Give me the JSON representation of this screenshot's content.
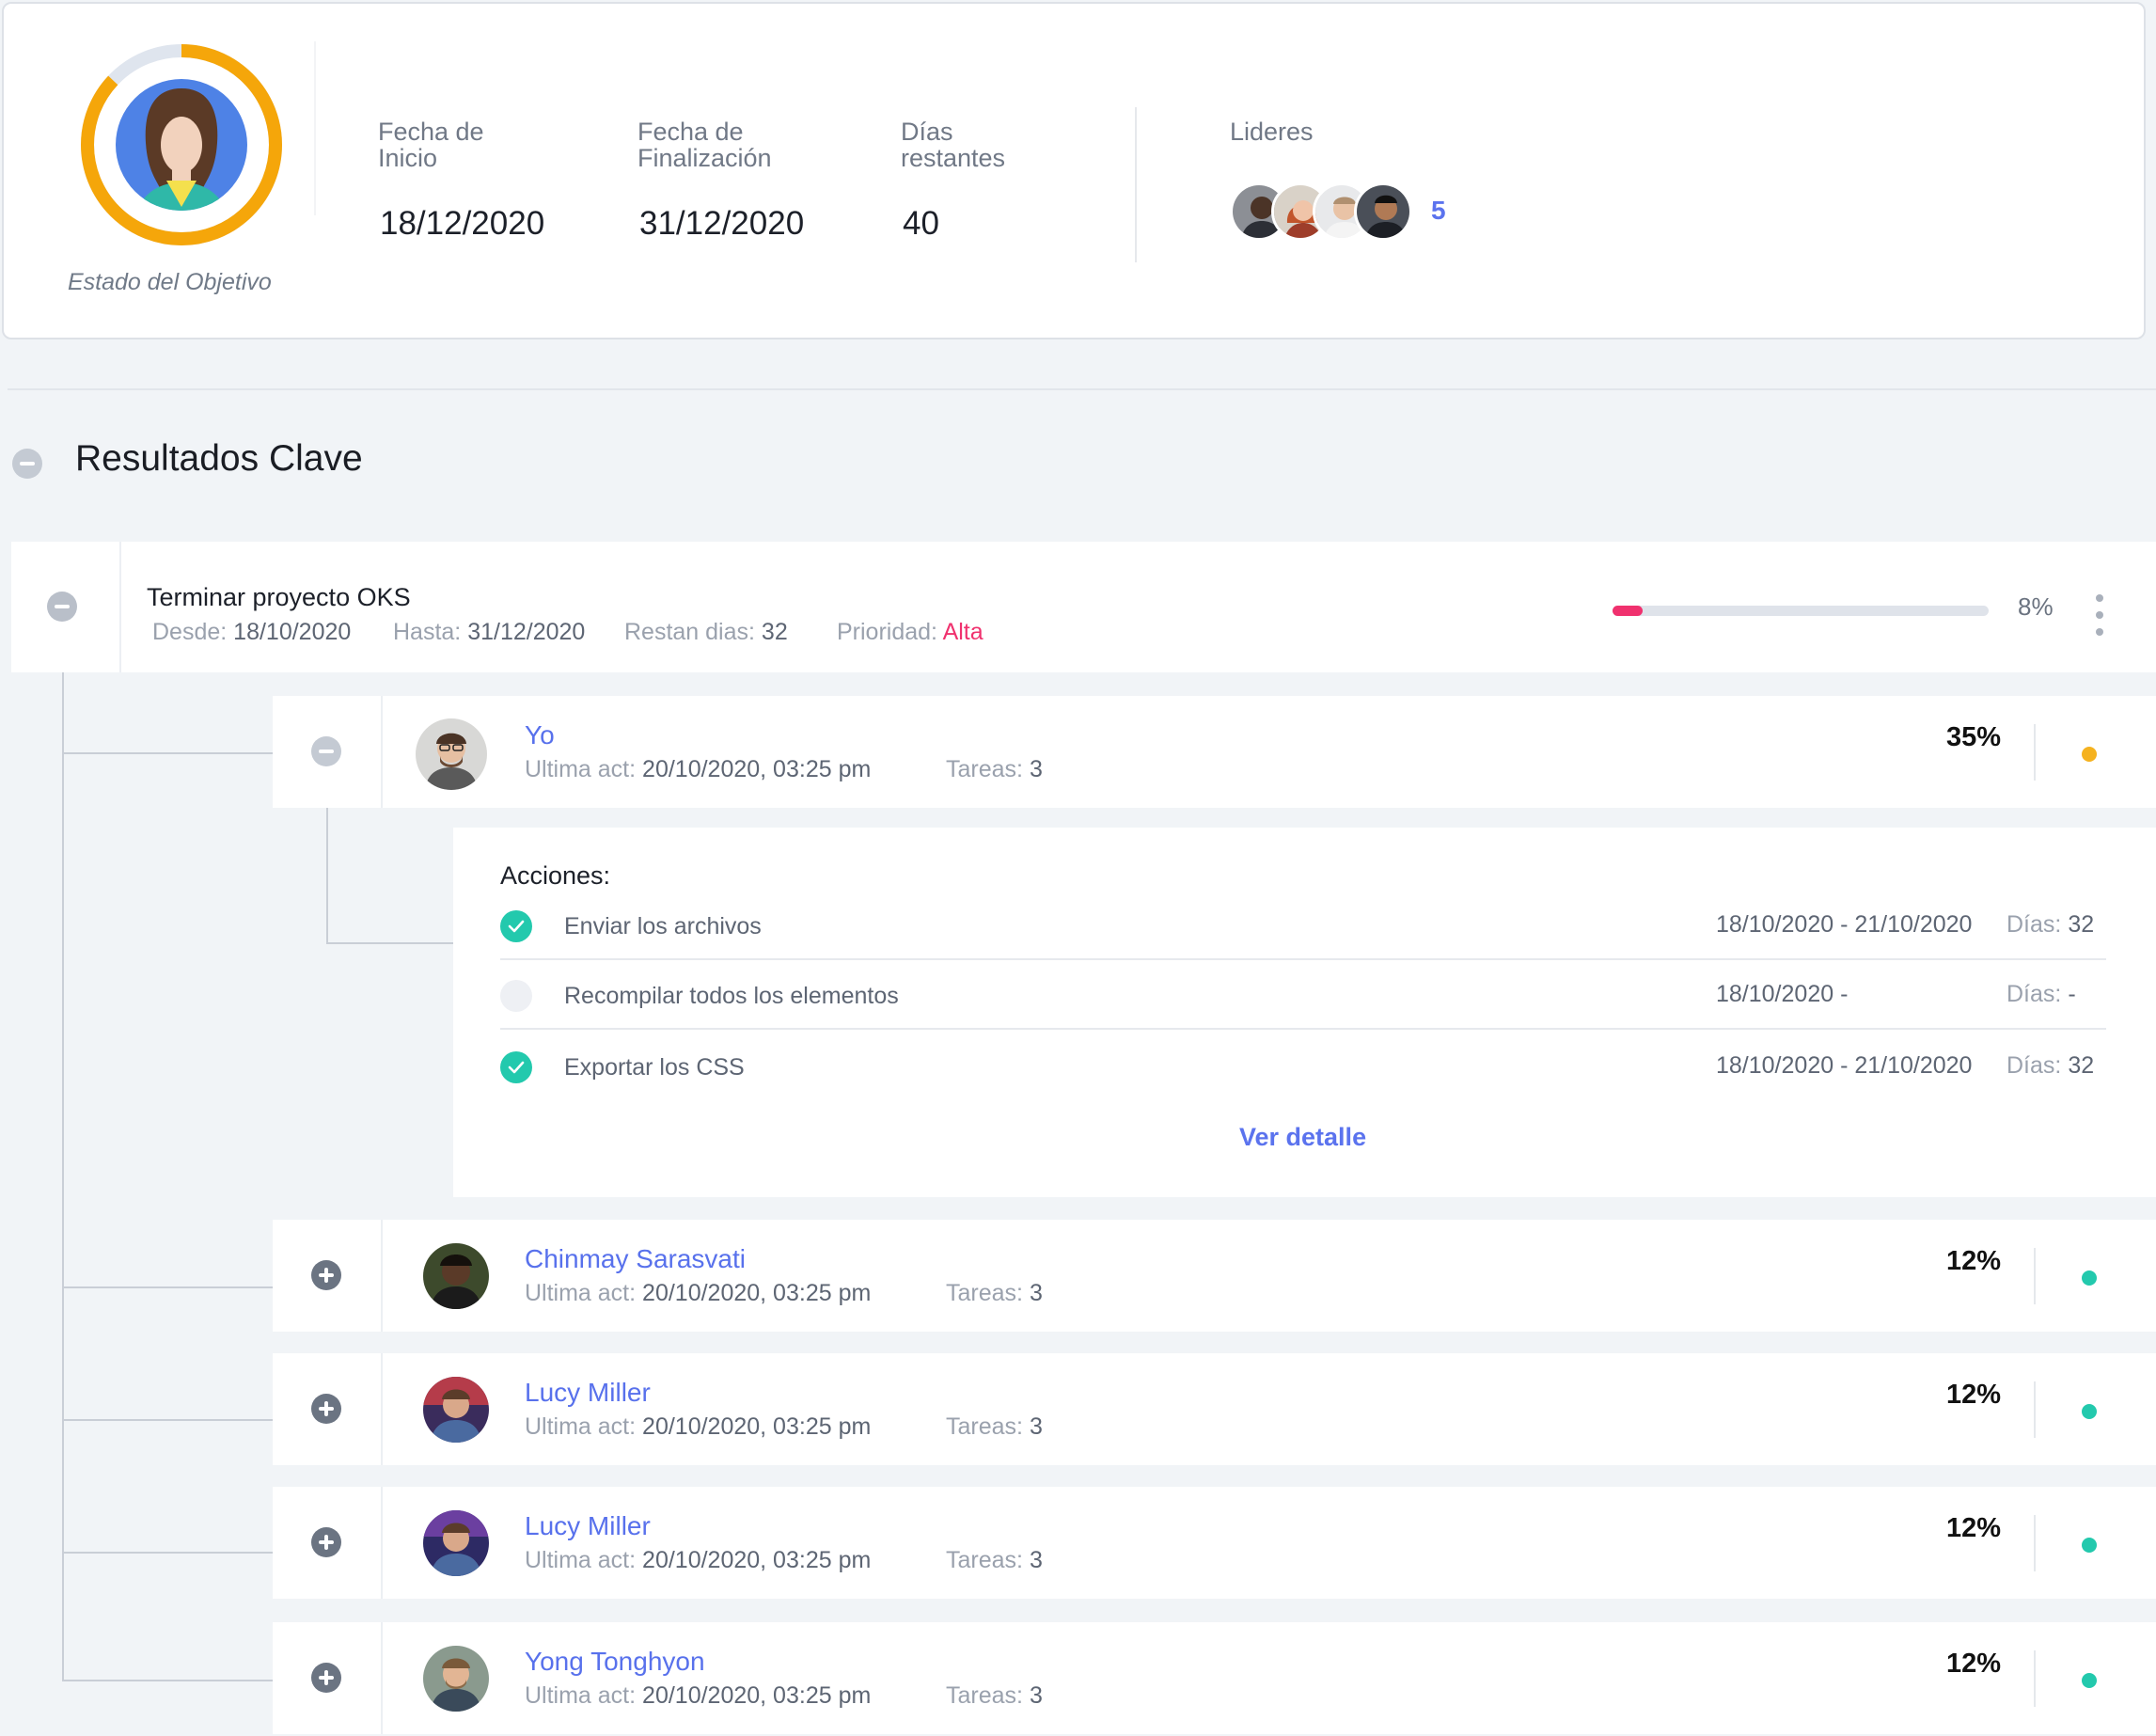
{
  "objective": {
    "status_caption": "Estado del Objetivo",
    "progress_ring_percent": 87,
    "colors": {
      "ring_fill": "#f5a60a",
      "ring_track": "#dfe5ee",
      "avatar_bg": "#4e82e6"
    },
    "fields": [
      {
        "label": "Fecha de Inicio",
        "value": "18/12/2020"
      },
      {
        "label": "Fecha de Finalización",
        "value": "31/12/2020"
      },
      {
        "label": "Días restantes",
        "value": "40"
      }
    ],
    "leaders": {
      "label": "Lideres",
      "count": "5"
    }
  },
  "section": {
    "title": "Resultados Clave"
  },
  "key_result": {
    "title": "Terminar proyecto OKS",
    "desde_label": "Desde:",
    "desde": "18/10/2020",
    "hasta_label": "Hasta:",
    "hasta": "31/12/2020",
    "restan_label": "Restan dias:",
    "restan": "32",
    "prioridad_label": "Prioridad:",
    "prioridad": "Alta",
    "progress": 8,
    "progress_label": "8%",
    "colors": {
      "progress": "#f0316e",
      "priority": "#f0316e"
    }
  },
  "members": [
    {
      "name": "Yo",
      "ultima_label": "Ultima act:",
      "ultima": "20/10/2020, 03:25 pm",
      "tareas_label": "Tareas:",
      "tareas": "3",
      "percent": "35%",
      "status_color": "#f5b21f",
      "expanded": true
    },
    {
      "name": "Chinmay Sarasvati",
      "ultima_label": "Ultima act:",
      "ultima": "20/10/2020, 03:25 pm",
      "tareas_label": "Tareas:",
      "tareas": "3",
      "percent": "12%",
      "status_color": "#23c9ad",
      "expanded": false
    },
    {
      "name": "Lucy Miller",
      "ultima_label": "Ultima act:",
      "ultima": "20/10/2020, 03:25 pm",
      "tareas_label": "Tareas:",
      "tareas": "3",
      "percent": "12%",
      "status_color": "#23c9ad",
      "expanded": false
    },
    {
      "name": "Lucy Miller",
      "ultima_label": "Ultima act:",
      "ultima": "20/10/2020, 03:25 pm",
      "tareas_label": "Tareas:",
      "tareas": "3",
      "percent": "12%",
      "status_color": "#23c9ad",
      "expanded": false
    },
    {
      "name": "Yong Tonghyon",
      "ultima_label": "Ultima act:",
      "ultima": "20/10/2020, 03:25 pm",
      "tareas_label": "Tareas:",
      "tareas": "3",
      "percent": "12%",
      "status_color": "#23c9ad",
      "expanded": false
    }
  ],
  "actions": {
    "title": "Acciones:",
    "items": [
      {
        "text": "Enviar los archivos",
        "dates": "18/10/2020 - 21/10/2020",
        "dias_label": "Días:",
        "dias": "32",
        "done": true
      },
      {
        "text": "Recompilar todos los elementos",
        "dates": "18/10/2020 -",
        "dias_label": "Días:",
        "dias": "-",
        "done": false
      },
      {
        "text": "Exportar los CSS",
        "dates": "18/10/2020 - 21/10/2020",
        "dias_label": "Días:",
        "dias": "32",
        "done": true
      }
    ],
    "link_label": "Ver detalle"
  }
}
